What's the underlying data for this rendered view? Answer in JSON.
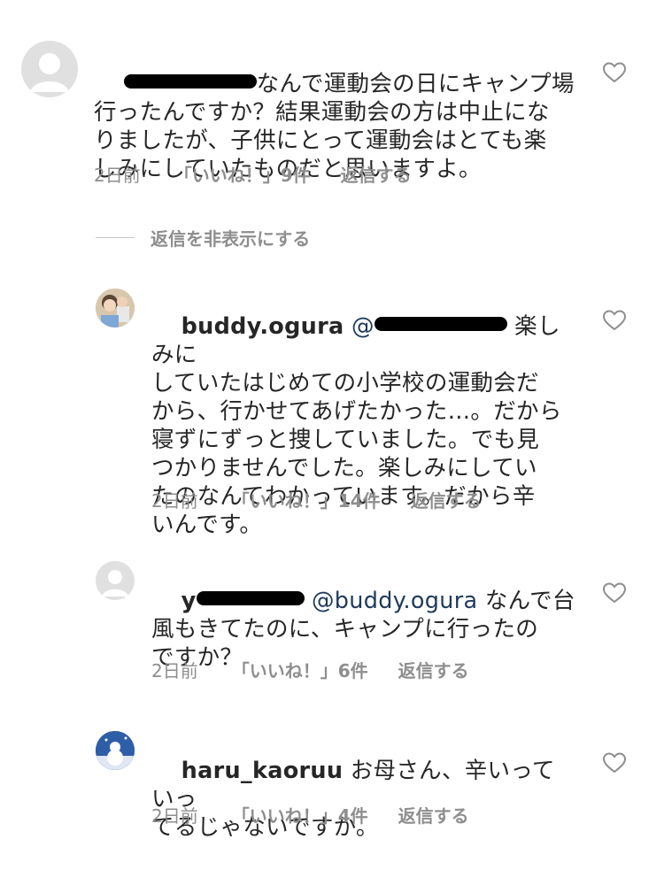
{
  "comments": [
    {
      "user": "",
      "text_lines": [
        "なんで運動会の日にキャンプ場",
        "行ったんですか？結果運動会の方は中止にな",
        "りましたが、子供にとって運動会はとても楽",
        "しみにしていたものだと思いますよ。"
      ],
      "time": "2日前",
      "likes": "「いいね！」9件",
      "reply": "返信する"
    },
    {
      "user": "buddy.ogura",
      "mention": "@",
      "text_lines": [
        "楽しみに",
        "していたはじめての小学校の運動会だ",
        "から、行かせてあげたかった…。だから",
        "寝ずにずっと捜していました。でも見",
        "つかりませんでした。楽しみにしてい",
        "たのなんてわかっています。だから辛",
        "いんです。"
      ],
      "time": "2日前",
      "likes": "「いいね！」14件",
      "reply": "返信する"
    },
    {
      "user": "y",
      "mention": "@buddy.ogura",
      "text_lines": [
        "なんで台",
        "風もきてたのに、キャンプに行ったの",
        "ですか？"
      ],
      "time": "2日前",
      "likes": "「いいね！」6件",
      "reply": "返信する"
    },
    {
      "user": "haru_kaoruu",
      "text_lines": [
        "お母さん、辛いっていっ",
        "てるじゃないですか。"
      ],
      "time": "2日前",
      "likes": "「いいね！」4件",
      "reply": "返信する"
    }
  ],
  "hide_replies_label": "返信を非表示にする",
  "icons": {
    "like": "heart-outline-icon",
    "avatar_default": "default-avatar-icon"
  },
  "colors": {
    "meta_text": "#8e8e8e",
    "mention": "#1f3a5c",
    "heart": "#8e8e8e"
  }
}
